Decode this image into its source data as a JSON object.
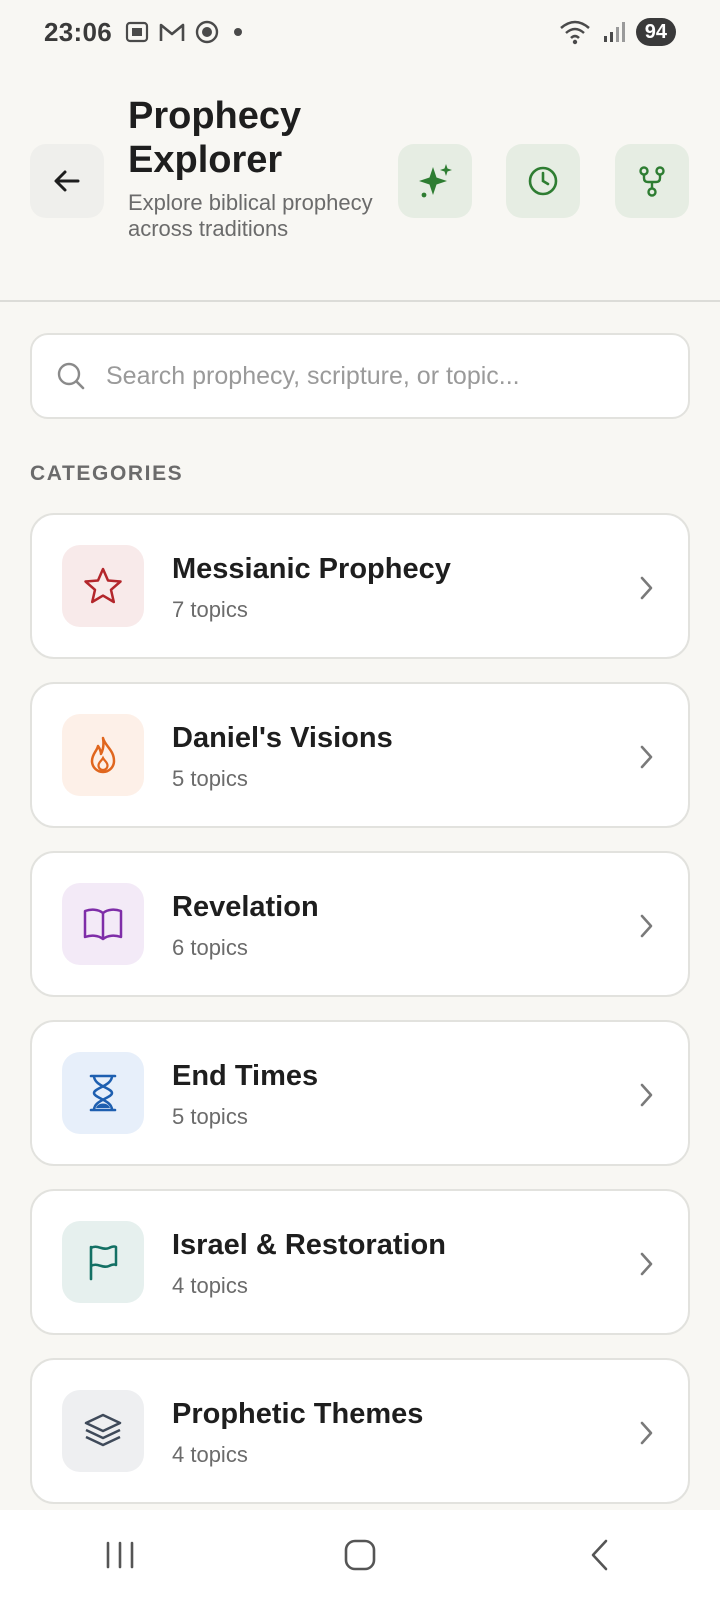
{
  "status_bar": {
    "time": "23:06",
    "battery": "94",
    "icons": [
      "screenshot-icon",
      "gmail-icon",
      "record-icon",
      "dot-icon",
      "wifi-icon",
      "signal-icon"
    ]
  },
  "header": {
    "title": "Prophecy Explorer",
    "subtitle": "Explore biblical prophecy across traditions",
    "actions": [
      "sparkles-icon",
      "history-icon",
      "branch-icon"
    ]
  },
  "search": {
    "placeholder": "Search prophecy, scripture, or topic..."
  },
  "categories_label": "CATEGORIES",
  "categories": [
    {
      "name": "Messianic Prophecy",
      "count": "7 topics",
      "icon": "star-icon",
      "color": "#B3262B",
      "bg": "#F8EAEA"
    },
    {
      "name": "Daniel's Visions",
      "count": "5 topics",
      "icon": "flame-icon",
      "color": "#E0661E",
      "bg": "#FDF0E8"
    },
    {
      "name": "Revelation",
      "count": "6 topics",
      "icon": "open-book-icon",
      "color": "#7E2DA8",
      "bg": "#F3EAF7"
    },
    {
      "name": "End Times",
      "count": "5 topics",
      "icon": "hourglass-icon",
      "color": "#1E5FB0",
      "bg": "#E7EFFA"
    },
    {
      "name": "Israel & Restoration",
      "count": "4 topics",
      "icon": "flag-icon",
      "color": "#137064",
      "bg": "#E6F0EE"
    },
    {
      "name": "Prophetic Themes",
      "count": "4 topics",
      "icon": "layers-icon",
      "color": "#3F4A5A",
      "bg": "#EEEFF1"
    }
  ],
  "colors": {
    "accent": "#2E7D32",
    "background": "#F8F7F3",
    "card": "#FFFFFF"
  }
}
